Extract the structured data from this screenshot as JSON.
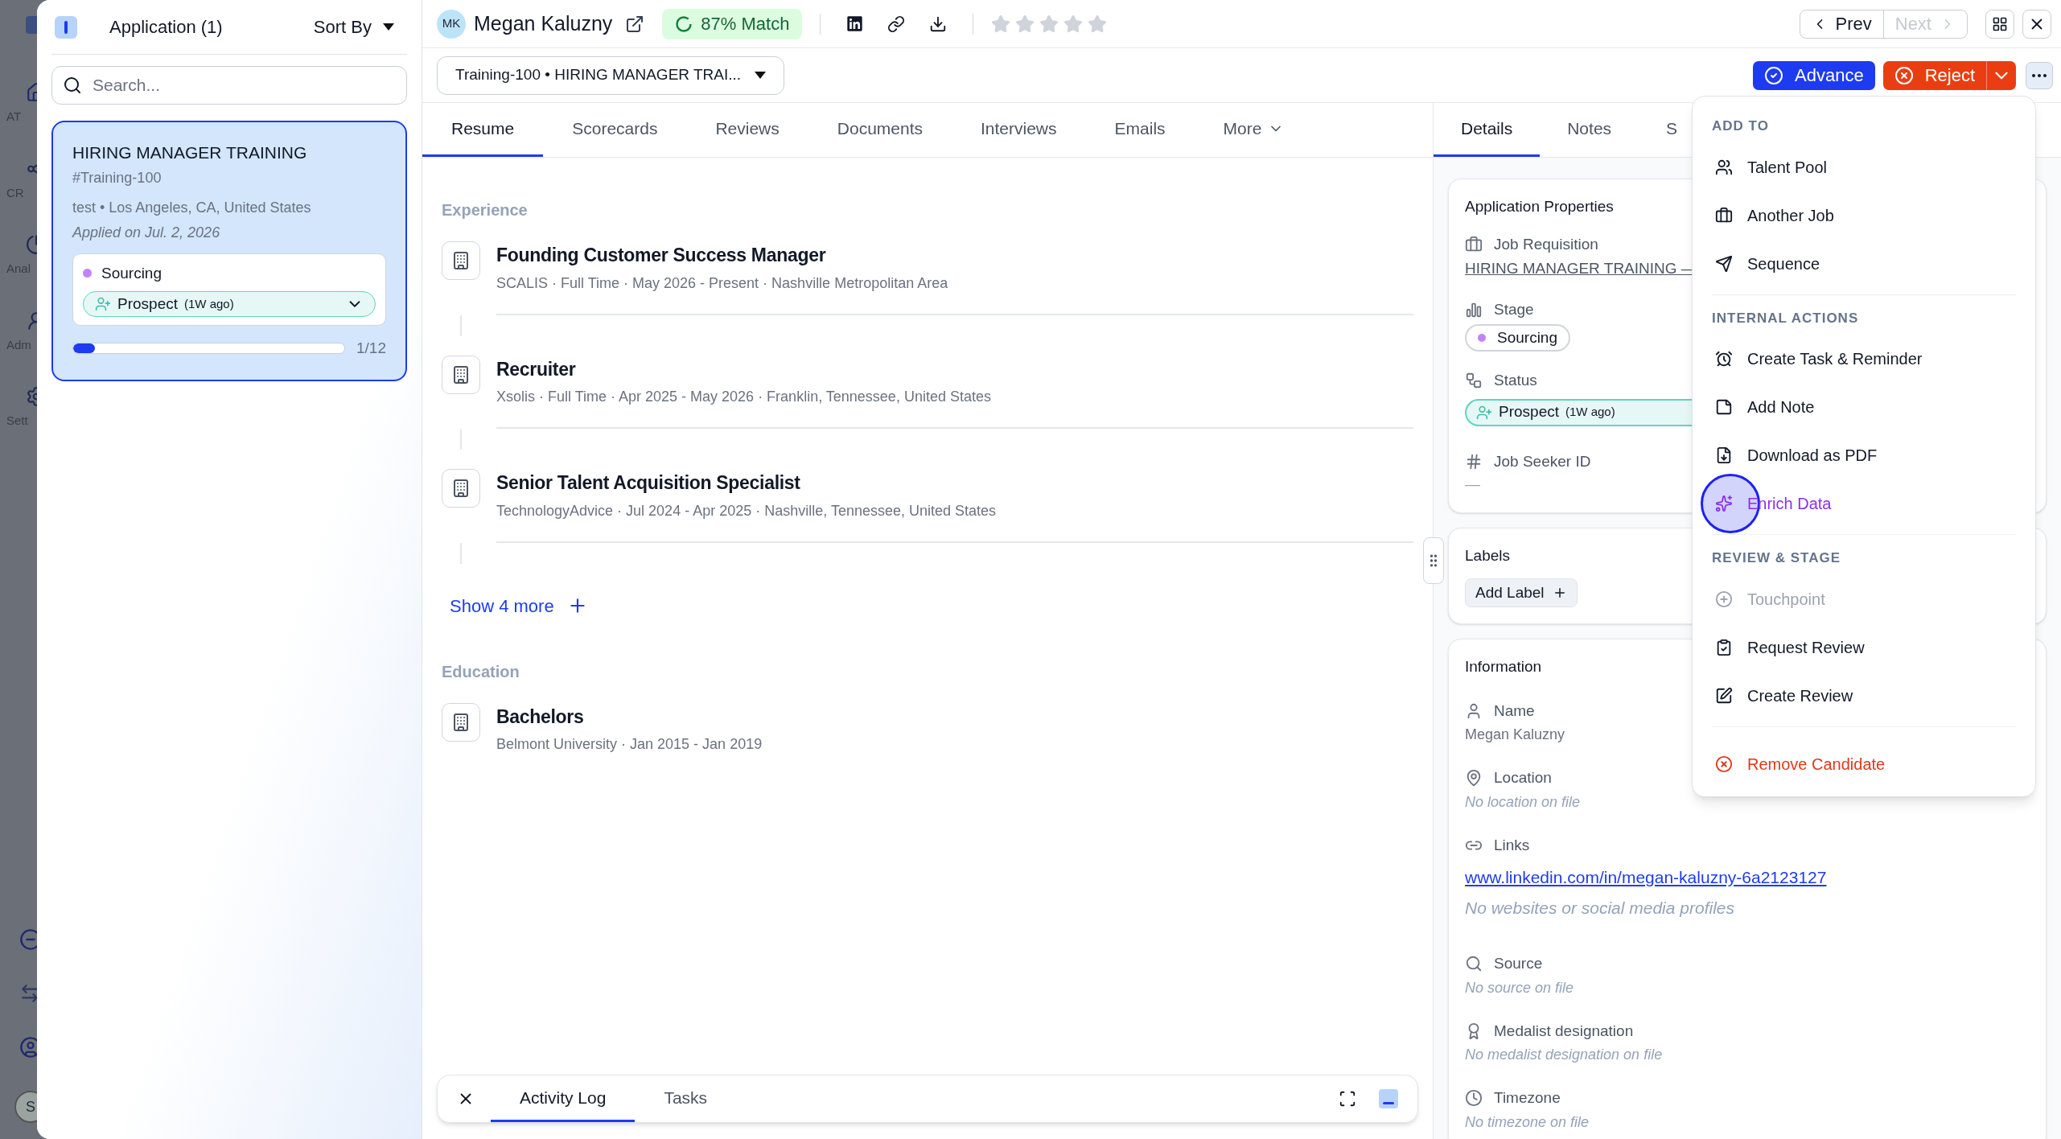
{
  "nav": {
    "items": [
      {
        "label": "AT",
        "selected": true
      },
      {
        "label": "CR",
        "selected": false
      },
      {
        "label": "Anal",
        "selected": false
      },
      {
        "label": "Adm",
        "selected": false
      },
      {
        "label": "Sett",
        "selected": false
      }
    ],
    "avatar": "S"
  },
  "applications": {
    "title": "Application (1)",
    "sort": "Sort By",
    "search": {
      "placeholder": "Search..."
    },
    "cards": [
      {
        "title": "HIRING MANAGER TRAINING",
        "code": "#Training-100",
        "place": "test • Los Angeles, CA, United States",
        "applied": "Applied on Jul. 2, 2026",
        "stage": {
          "label": "Sourcing",
          "color": "#c084fc"
        },
        "status": "Prospect",
        "status_age": "(1W ago)",
        "level": 0.08,
        "progress": "1/12",
        "selected": true
      }
    ]
  },
  "candidate": {
    "initials": "MK",
    "name": "Megan Kaluzny",
    "match": "87% Match",
    "stars": 0,
    "prev": "Prev",
    "next": "Next",
    "next_disabled": true
  },
  "job_select": "Training-100 • HIRING MANAGER TRAI...",
  "actions": {
    "advance": "Advance",
    "reject": "Reject"
  },
  "tabs": [
    {
      "label": "Resume",
      "selected": true
    },
    {
      "label": "Scorecards",
      "selected": false
    },
    {
      "label": "Reviews",
      "selected": false
    },
    {
      "label": "Documents",
      "selected": false
    },
    {
      "label": "Interviews",
      "selected": false
    },
    {
      "label": "Emails",
      "selected": false
    },
    {
      "label": "More",
      "selected": false
    }
  ],
  "experience": {
    "heading": "Experience",
    "entries": [
      {
        "title": "Founding Customer Success Manager",
        "meta": "SCALIS · Full Time · May 2026 - Present · Nashville Metropolitan Area"
      },
      {
        "title": "Recruiter",
        "meta": "Xsolis · Full Time · Apr 2025 - May 2026 · Franklin, Tennessee, United States"
      },
      {
        "title": "Senior Talent Acquisition Specialist",
        "meta": "TechnologyAdvice · Jul 2024 - Apr 2025 · Nashville, Tennessee, United States"
      }
    ],
    "show_more": "Show 4 more"
  },
  "education": {
    "heading": "Education",
    "entries": [
      {
        "title": "Bachelors",
        "meta": "Belmont University · Jan 2015 - Jan 2019"
      }
    ]
  },
  "bottom_tabs": [
    {
      "label": "Activity Log",
      "selected": true
    },
    {
      "label": "Tasks",
      "selected": false
    }
  ],
  "side_tabs": [
    {
      "label": "Details",
      "selected": true
    },
    {
      "label": "Notes",
      "selected": false
    },
    {
      "label": "S",
      "selected": false
    }
  ],
  "app_properties": {
    "title": "Application Properties",
    "requisition_label": "Job Requisition",
    "requisition": "HIRING MANAGER TRAINING —",
    "stage_label": "Stage",
    "stage": {
      "label": "Sourcing",
      "color": "#c084fc"
    },
    "status_label": "Status",
    "status": "Prospect",
    "status_age": "(1W ago)",
    "seeker_label": "Job Seeker ID",
    "seeker": "—"
  },
  "labels": {
    "title": "Labels",
    "add": "Add Label"
  },
  "information": {
    "title": "Information",
    "fields": [
      {
        "label": "Name",
        "value": "Megan Kaluzny",
        "empty": false
      },
      {
        "label": "Location",
        "value": "No location on file",
        "empty": true
      },
      {
        "label": "Links",
        "link": "www.linkedin.com/in/megan-kaluzny-6a2123127",
        "value": "No websites or social media profiles",
        "empty": true
      },
      {
        "label": "Source",
        "value": "No source on file",
        "empty": true
      },
      {
        "label": "Medalist designation",
        "value": "No medalist designation on file",
        "empty": true
      },
      {
        "label": "Timezone",
        "value": "No timezone on file",
        "empty": true
      }
    ]
  },
  "menu": {
    "sections": [
      {
        "kind": "group",
        "title": "ADD TO",
        "items": [
          {
            "label": "Talent Pool",
            "disabled": false,
            "highlighted": false
          },
          {
            "label": "Another Job",
            "disabled": false,
            "highlighted": false
          },
          {
            "label": "Sequence",
            "disabled": false,
            "highlighted": false
          }
        ]
      },
      {
        "kind": "group",
        "title": "INTERNAL ACTIONS",
        "items": [
          {
            "label": "Create Task & Reminder",
            "disabled": false,
            "highlighted": false
          },
          {
            "label": "Add Note",
            "disabled": false,
            "highlighted": false
          },
          {
            "label": "Download as PDF",
            "disabled": false,
            "highlighted": false
          },
          {
            "label": "Enrich Data",
            "disabled": false,
            "highlighted": true
          }
        ]
      },
      {
        "kind": "group",
        "title": "REVIEW & STAGE",
        "items": [
          {
            "label": "Touchpoint",
            "disabled": true,
            "highlighted": false
          },
          {
            "label": "Request Review",
            "disabled": false,
            "highlighted": false
          },
          {
            "label": "Create Review",
            "disabled": false,
            "highlighted": false
          }
        ]
      },
      {
        "kind": "danger",
        "items": [
          {
            "label": "Remove Candidate",
            "disabled": false,
            "highlighted": false
          }
        ]
      }
    ]
  }
}
